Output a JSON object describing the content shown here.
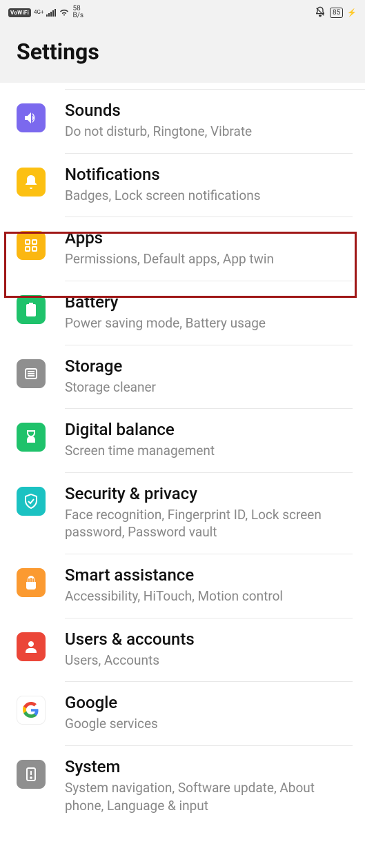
{
  "status": {
    "vowifi": "VoWiFi",
    "net": "4G+",
    "speed_num": "58",
    "speed_unit": "B/s",
    "battery": "85"
  },
  "header": {
    "title": "Settings"
  },
  "items": [
    {
      "key": "sounds",
      "title": "Sounds",
      "sub": "Do not disturb, Ringtone, Vibrate"
    },
    {
      "key": "notifications",
      "title": "Notifications",
      "sub": "Badges, Lock screen notifications"
    },
    {
      "key": "apps",
      "title": "Apps",
      "sub": "Permissions, Default apps, App twin"
    },
    {
      "key": "battery",
      "title": "Battery",
      "sub": "Power saving mode, Battery usage"
    },
    {
      "key": "storage",
      "title": "Storage",
      "sub": "Storage cleaner"
    },
    {
      "key": "digital",
      "title": "Digital balance",
      "sub": "Screen time management"
    },
    {
      "key": "security",
      "title": "Security & privacy",
      "sub": "Face recognition, Fingerprint ID, Lock screen password, Password vault"
    },
    {
      "key": "smart",
      "title": "Smart assistance",
      "sub": "Accessibility, HiTouch, Motion control"
    },
    {
      "key": "users",
      "title": "Users & accounts",
      "sub": "Users, Accounts"
    },
    {
      "key": "google",
      "title": "Google",
      "sub": "Google services"
    },
    {
      "key": "system",
      "title": "System",
      "sub": "System navigation, Software update, About phone, Language & input"
    }
  ]
}
